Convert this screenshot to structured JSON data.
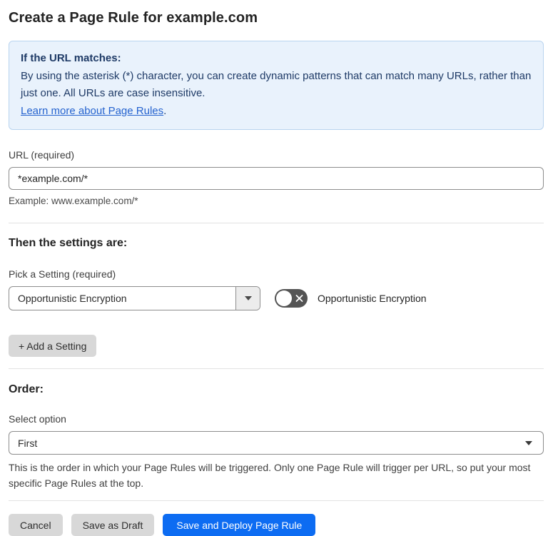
{
  "page": {
    "title": "Create a Page Rule for example.com"
  },
  "info_box": {
    "heading": "If the URL matches:",
    "body": "By using the asterisk (*) character, you can create dynamic patterns that can match many URLs, rather than just one. All URLs are case insensitive.",
    "link_label": "Learn more about Page Rules",
    "link_suffix": "."
  },
  "url_field": {
    "label": "URL (required)",
    "value": "*example.com/*",
    "hint": "Example: www.example.com/*"
  },
  "settings_section": {
    "heading": "Then the settings are:",
    "picker_label": "Pick a Setting (required)",
    "picker_value": "Opportunistic Encryption",
    "toggle_state": "off",
    "toggle_label": "Opportunistic Encryption",
    "add_setting_label": "+ Add a Setting"
  },
  "order_section": {
    "heading": "Order:",
    "select_label": "Select option",
    "select_value": "First",
    "description": "This is the order in which your Page Rules will be triggered. Only one Page Rule will trigger per URL, so put your most specific Page Rules at the top."
  },
  "footer": {
    "cancel_label": "Cancel",
    "save_draft_label": "Save as Draft",
    "save_deploy_label": "Save and Deploy Page Rule"
  },
  "colors": {
    "info_bg": "#e9f2fc",
    "info_border": "#b9d4ef",
    "info_text": "#1e3a66",
    "link_blue": "#2563cf",
    "primary_button_blue": "#0d6cf2",
    "toggle_off_gray": "#545454"
  }
}
